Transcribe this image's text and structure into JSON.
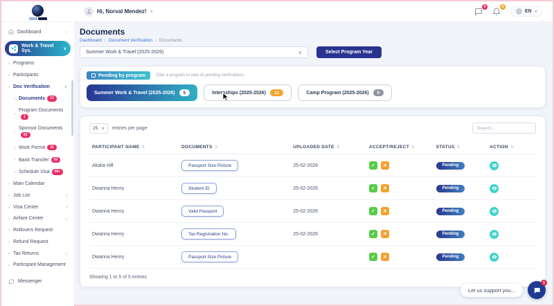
{
  "icons": {
    "chevron_right": "›",
    "chevron_down": "∨",
    "sort": "⇅",
    "check": "✓",
    "cross": "✕"
  },
  "topbar": {
    "greeting": "Hi, Norval Mendez!",
    "language": "EN",
    "messages_badge": "9",
    "notifications_badge": "8"
  },
  "sidebar": {
    "items": [
      {
        "label": "Dashboard"
      },
      {
        "label": "Work & Travel Sys."
      },
      {
        "label": "Programs"
      },
      {
        "label": "Participants"
      },
      {
        "label": "Doc Verification"
      },
      {
        "label": "Documents",
        "badge": "13"
      },
      {
        "label": "Program Documents",
        "badge": "1"
      },
      {
        "label": "Sponsor Documents",
        "badge": "63"
      },
      {
        "label": "Work Permit",
        "badge": "31"
      },
      {
        "label": "Bank Transfer",
        "badge": "59"
      },
      {
        "label": "Schedule Visa",
        "badge": "99+"
      },
      {
        "label": "Main Calendar"
      },
      {
        "label": "Job List"
      },
      {
        "label": "Visa Center"
      },
      {
        "label": "Airfare Center"
      },
      {
        "label": "Rollovers Request"
      },
      {
        "label": "Refund Request"
      },
      {
        "label": "Tax Returns"
      },
      {
        "label": "Participant Management"
      },
      {
        "label": "Messenger"
      }
    ]
  },
  "page": {
    "title": "Documents",
    "breadcrumb": [
      "Dashboard",
      "Document Verification",
      "Documents"
    ],
    "program_select": "Summer Work & Travel (2025-2026)",
    "select_year_button": "Select Program Year"
  },
  "pending_panel": {
    "chip": "Pending by program",
    "hint": "Click a program to view its pending verifications.",
    "tabs": [
      {
        "label": "Summer Work & Travel (2025-2026)",
        "count": "5"
      },
      {
        "label": "Internships (2025-2026)",
        "count": "12"
      },
      {
        "label": "Camp Program (2025-2026)",
        "count": "0"
      }
    ]
  },
  "table": {
    "entries_per_page": "25",
    "entries_label": "entries per page",
    "search_placeholder": "Search...",
    "columns": [
      "PARTICIPANT NAME",
      "DOCUMENTS",
      "UPLOADED DATE",
      "ACCEPT/REJECT",
      "STATUS",
      "ACTION"
    ],
    "rows": [
      {
        "name": "Akalia Hill",
        "document": "Passport Size Picture",
        "date": "25-02-2026",
        "status": "Pending"
      },
      {
        "name": "Dwanna Henry",
        "document": "Student ID",
        "date": "25-02-2026",
        "status": "Pending"
      },
      {
        "name": "Dwanna Henry",
        "document": "Valid Passport",
        "date": "25-02-2026",
        "status": "Pending"
      },
      {
        "name": "Dwanna Henry",
        "document": "Tax Registration No.",
        "date": "25-02-2026",
        "status": "Pending"
      },
      {
        "name": "Dwanna Henry",
        "document": "Passport Size Picture",
        "date": "",
        "status": "Pending"
      }
    ],
    "footer": "Showing 1 to 5 of 5 entries"
  },
  "chat": {
    "label": "Let us support you...",
    "badge": "5"
  },
  "colors": {
    "accent_gradient_start": "#283593",
    "accent_gradient_end": "#2fb0c4",
    "accept_green": "#56cc49",
    "reject_orange": "#f2a12e",
    "badge_pink": "#ec2c64",
    "badge_orange": "#f2a42c",
    "action_teal": "#43d3cb",
    "primary_button": "#27338f"
  }
}
